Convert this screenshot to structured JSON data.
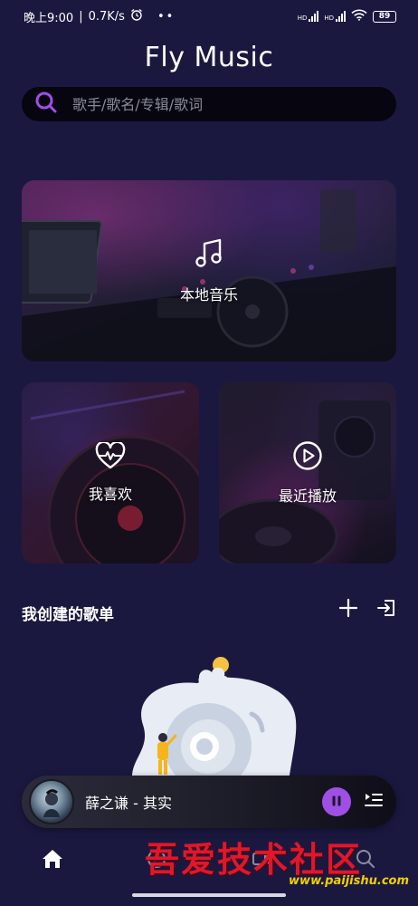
{
  "status_bar": {
    "time": "晚上9:00",
    "speed": "0.7K/s",
    "battery": "89",
    "signal_label": "HD"
  },
  "app": {
    "title": "Fly Music"
  },
  "search": {
    "placeholder": "歌手/歌名/专辑/歌词",
    "value": ""
  },
  "cards": {
    "local_music": "本地音乐",
    "favorites": "我喜欢",
    "recent": "最近播放"
  },
  "playlist_section": {
    "title": "我创建的歌单"
  },
  "player": {
    "song": "薛之谦 - 其实"
  },
  "nav": {
    "active": "home"
  },
  "watermark": {
    "text": "吾爱技术社区",
    "url": "www.paijishu.com"
  },
  "colors": {
    "background": "#1b1840",
    "accent": "#a04fe6",
    "search_bg": "#060510"
  },
  "icons": {
    "search": "search-icon",
    "local": "music-note-icon",
    "favorites": "heart-pulse-icon",
    "recent": "play-circle-icon",
    "add": "plus-icon",
    "import": "import-icon",
    "pause": "pause-icon",
    "queue": "playlist-icon",
    "home": "home-icon"
  }
}
